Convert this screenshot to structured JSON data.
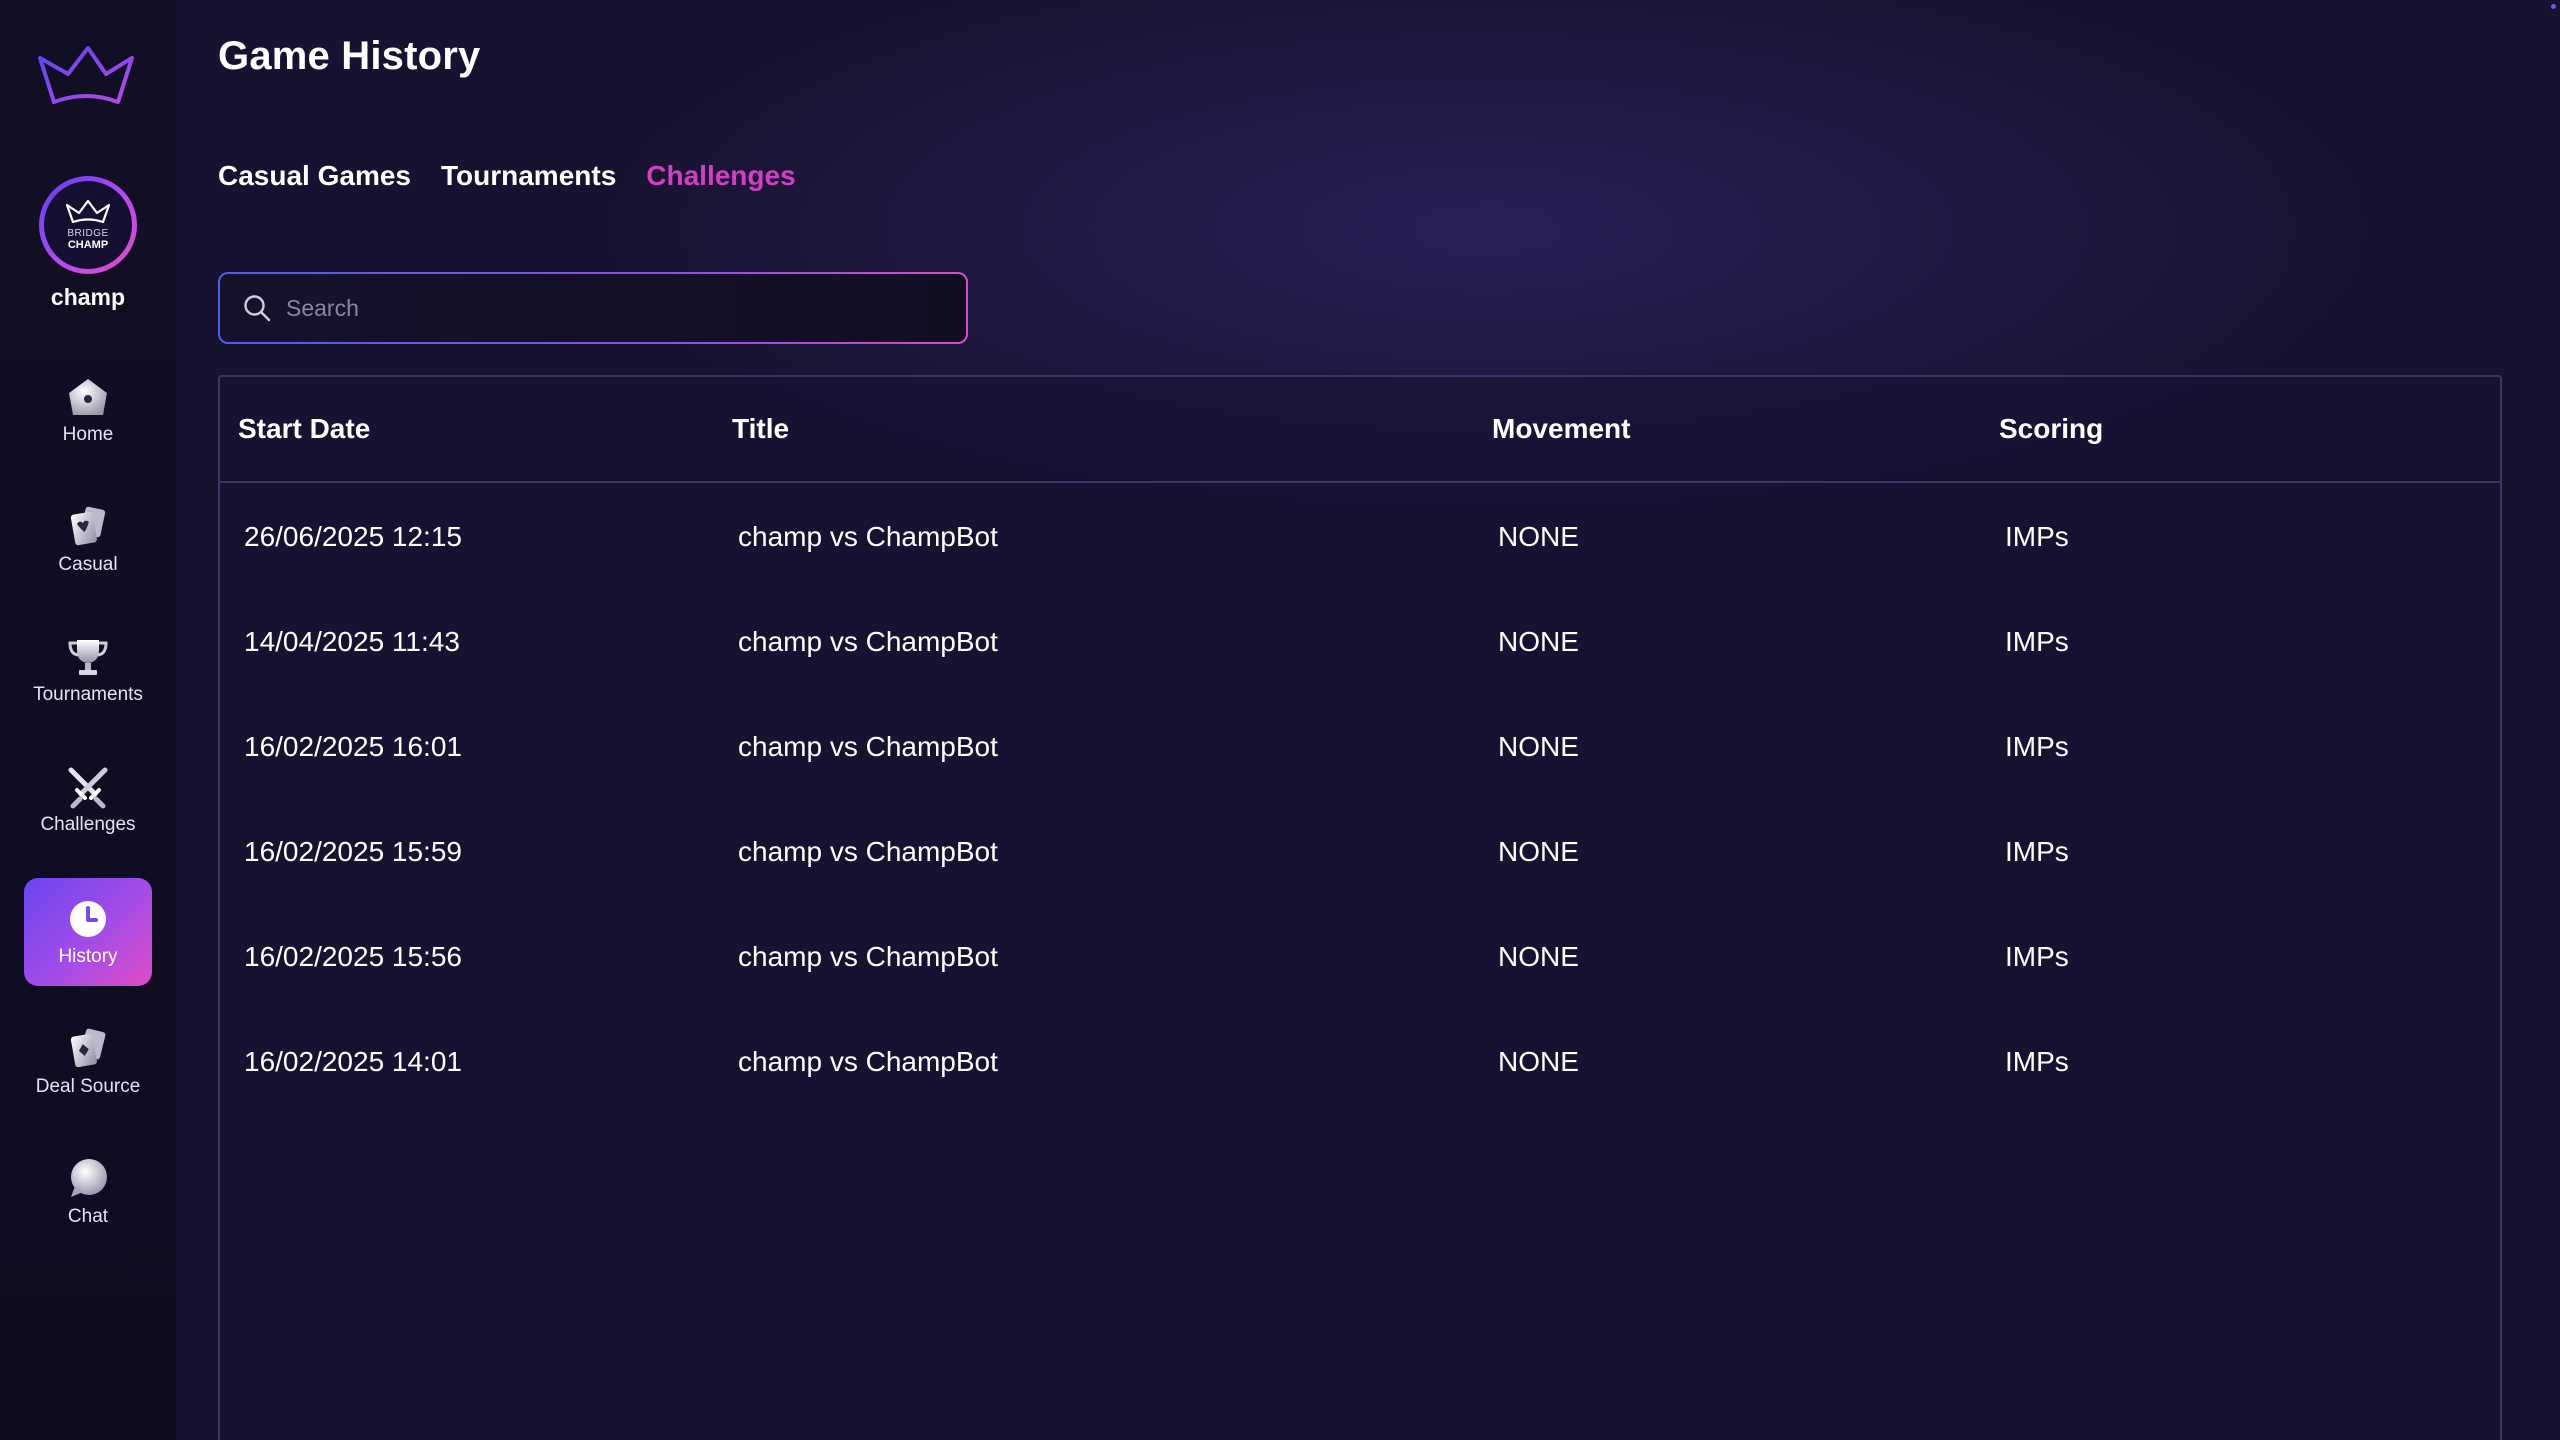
{
  "sidebar": {
    "logo_icon": "crown-outline-icon",
    "profile": {
      "avatar_line1": "BRIDGE",
      "avatar_line2": "CHAMP",
      "username": "champ"
    },
    "items": [
      {
        "label": "Home",
        "icon": "home-icon",
        "active": false
      },
      {
        "label": "Casual",
        "icon": "cards-icon",
        "active": false
      },
      {
        "label": "Tournaments",
        "icon": "trophy-icon",
        "active": false
      },
      {
        "label": "Challenges",
        "icon": "crossed-swords-icon",
        "active": false
      },
      {
        "label": "History",
        "icon": "clock-icon",
        "active": true
      },
      {
        "label": "Deal Source",
        "icon": "deal-cards-icon",
        "active": false
      },
      {
        "label": "Chat",
        "icon": "chat-bubble-icon",
        "active": false
      }
    ]
  },
  "main": {
    "title": "Game History",
    "tabs": [
      {
        "label": "Casual Games",
        "active": false
      },
      {
        "label": "Tournaments",
        "active": false
      },
      {
        "label": "Challenges",
        "active": true
      }
    ],
    "search": {
      "placeholder": "Search",
      "value": ""
    },
    "table": {
      "columns": [
        "Start Date",
        "Title",
        "Movement",
        "Scoring"
      ],
      "rows": [
        [
          "26/06/2025 12:15",
          "champ vs ChampBot",
          "NONE",
          "IMPs"
        ],
        [
          "14/04/2025 11:43",
          "champ vs ChampBot",
          "NONE",
          "IMPs"
        ],
        [
          "16/02/2025 16:01",
          "champ vs ChampBot",
          "NONE",
          "IMPs"
        ],
        [
          "16/02/2025 15:59",
          "champ vs ChampBot",
          "NONE",
          "IMPs"
        ],
        [
          "16/02/2025 15:56",
          "champ vs ChampBot",
          "NONE",
          "IMPs"
        ],
        [
          "16/02/2025 14:01",
          "champ vs ChampBot",
          "NONE",
          "IMPs"
        ]
      ]
    }
  },
  "colors": {
    "background": "#171230",
    "sidebar": "#110d23",
    "accent_pink": "#d23fc4",
    "accent_purple": "#6a45f2",
    "table_border": "#3a3762"
  }
}
